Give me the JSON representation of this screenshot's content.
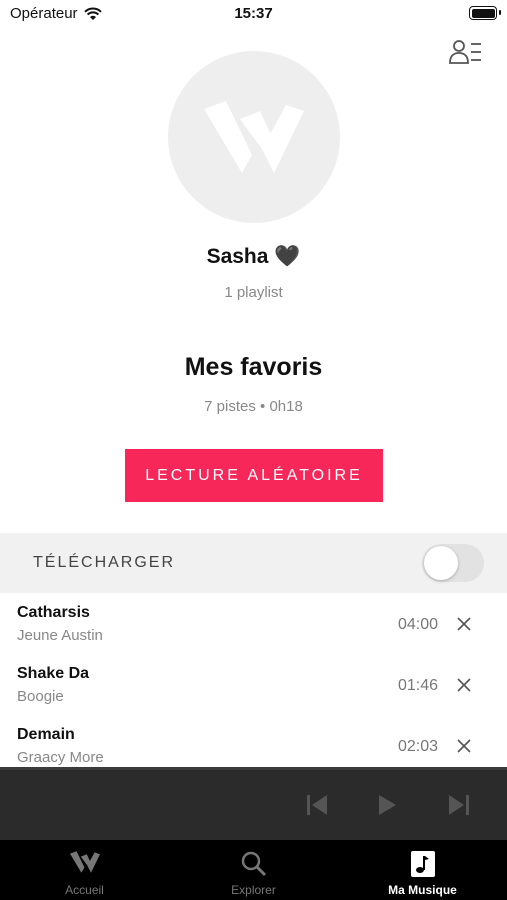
{
  "status_bar": {
    "carrier": "Opérateur",
    "time": "15:37"
  },
  "profile": {
    "name": "Sasha 🖤",
    "playlist_count": "1 playlist"
  },
  "playlist": {
    "title": "Mes favoris",
    "meta": "7 pistes • 0h18",
    "shuffle_label": "LECTURE ALÉATOIRE",
    "download_label": "TÉLÉCHARGER",
    "download_enabled": false
  },
  "tracks": [
    {
      "title": "Catharsis",
      "artist": "Jeune Austin",
      "duration": "04:00"
    },
    {
      "title": "Shake Da",
      "artist": "Boogie",
      "duration": "01:46"
    },
    {
      "title": "Demain",
      "artist": "Graacy More",
      "duration": "02:03"
    }
  ],
  "player": {
    "icons": [
      "previous-icon",
      "play-icon",
      "next-icon"
    ]
  },
  "tab_bar": {
    "tabs": [
      {
        "label": "Accueil",
        "icon": "logo-icon"
      },
      {
        "label": "Explorer",
        "icon": "search-icon"
      },
      {
        "label": "Ma Musique",
        "icon": "music-note-icon"
      }
    ],
    "active_index": 2
  },
  "colors": {
    "accent": "#f7275a",
    "player_bg": "#2b2b2b",
    "tab_bg": "#000000"
  }
}
